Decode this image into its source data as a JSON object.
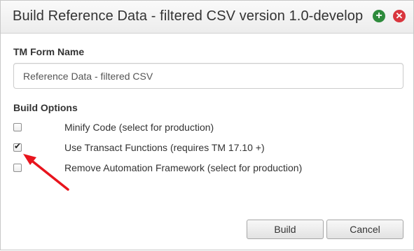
{
  "dialog": {
    "title": "Build Reference Data - filtered CSV version 1.0-develop",
    "add_icon": "plus-circle-icon",
    "close_icon": "close-circle-icon",
    "colors": {
      "add": "#2e8b3c",
      "close": "#d9363e"
    }
  },
  "form": {
    "name_label": "TM Form Name",
    "name_value": "Reference Data - filtered CSV",
    "options_label": "Build Options",
    "options": [
      {
        "label": "Minify Code (select for production)",
        "checked": false
      },
      {
        "label": "Use Transact Functions (requires TM 17.10 +)",
        "checked": true
      },
      {
        "label": "Remove Automation Framework (select for production)",
        "checked": false
      }
    ]
  },
  "annotation": {
    "arrow_color": "#e8141d"
  },
  "buttons": {
    "build": "Build",
    "cancel": "Cancel"
  }
}
